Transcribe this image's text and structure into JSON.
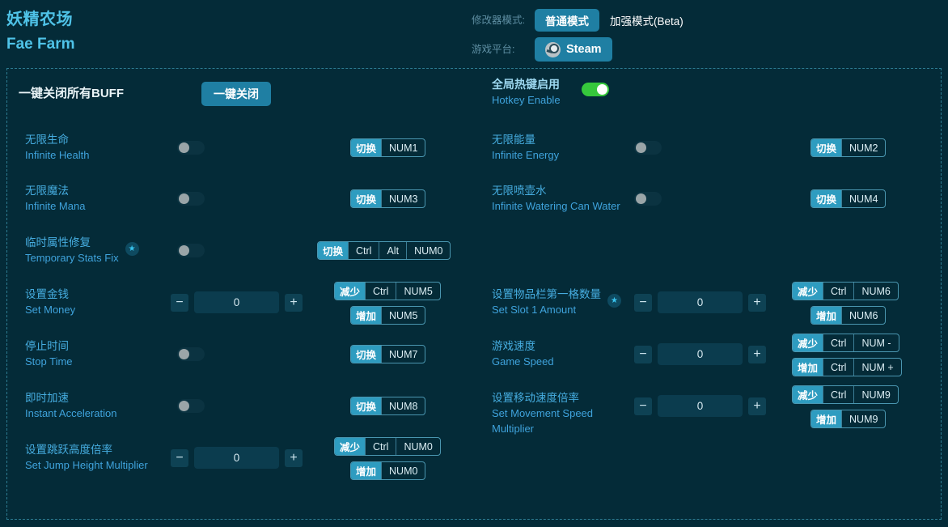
{
  "header": {
    "title_cn": "妖精农场",
    "title_en": "Fae Farm",
    "mode_label": "修改器模式:",
    "mode_normal": "普通模式",
    "mode_enhanced": "加强模式(Beta)",
    "platform_label": "游戏平台:",
    "platform_value": "Steam",
    "star_glyph": "★",
    "minus_glyph": "−",
    "plus_glyph": "+"
  },
  "left": {
    "close_all": {
      "label_cn": "一键关闭所有BUFF",
      "button": "一键关闭"
    },
    "rows": [
      {
        "label_cn": "无限生命",
        "label_en": "Infinite Health",
        "hotkeys": [
          {
            "action": "切换",
            "keys": [
              "NUM1"
            ]
          }
        ]
      },
      {
        "label_cn": "无限魔法",
        "label_en": "Infinite Mana",
        "hotkeys": [
          {
            "action": "切换",
            "keys": [
              "NUM3"
            ]
          }
        ]
      },
      {
        "label_cn": "临时属性修复",
        "label_en": "Temporary Stats Fix",
        "star": true,
        "hotkeys": [
          {
            "action": "切换",
            "keys": [
              "Ctrl",
              "Alt",
              "NUM0"
            ]
          }
        ]
      },
      {
        "label_cn": "设置金钱",
        "label_en": "Set Money",
        "value": "0",
        "hotkeys": [
          {
            "action": "减少",
            "keys": [
              "Ctrl",
              "NUM5"
            ]
          },
          {
            "action": "增加",
            "keys": [
              "NUM5"
            ]
          }
        ]
      },
      {
        "label_cn": "停止时间",
        "label_en": "Stop Time",
        "hotkeys": [
          {
            "action": "切换",
            "keys": [
              "NUM7"
            ]
          }
        ]
      },
      {
        "label_cn": "即时加速",
        "label_en": "Instant Acceleration",
        "hotkeys": [
          {
            "action": "切换",
            "keys": [
              "NUM8"
            ]
          }
        ]
      },
      {
        "label_cn": "设置跳跃高度倍率",
        "label_en": "Set Jump Height Multiplier",
        "value": "0",
        "hotkeys": [
          {
            "action": "减少",
            "keys": [
              "Ctrl",
              "NUM0"
            ]
          },
          {
            "action": "增加",
            "keys": [
              "NUM0"
            ]
          }
        ]
      }
    ]
  },
  "right": {
    "hotkey_enable": {
      "label_cn": "全局热键启用",
      "label_en": "Hotkey Enable",
      "state": "on"
    },
    "rows": [
      {
        "label_cn": "无限能量",
        "label_en": "Infinite Energy",
        "hotkeys": [
          {
            "action": "切换",
            "keys": [
              "NUM2"
            ]
          }
        ]
      },
      {
        "label_cn": "无限喷壶水",
        "label_en": "Infinite Watering Can Water",
        "hotkeys": [
          {
            "action": "切换",
            "keys": [
              "NUM4"
            ]
          }
        ]
      },
      {
        "label_cn": "设置物品栏第一格数量",
        "label_en": "Set Slot 1 Amount",
        "star": true,
        "value": "0",
        "hotkeys": [
          {
            "action": "减少",
            "keys": [
              "Ctrl",
              "NUM6"
            ]
          },
          {
            "action": "增加",
            "keys": [
              "NUM6"
            ]
          }
        ]
      },
      {
        "label_cn": "游戏速度",
        "label_en": "Game Speed",
        "value": "0",
        "hotkeys": [
          {
            "action": "减少",
            "keys": [
              "Ctrl",
              "NUM -"
            ]
          },
          {
            "action": "增加",
            "keys": [
              "Ctrl",
              "NUM +"
            ]
          }
        ]
      },
      {
        "label_cn": "设置移动速度倍率",
        "label_en": "Set Movement Speed Multiplier",
        "value": "0",
        "hotkeys": [
          {
            "action": "减少",
            "keys": [
              "Ctrl",
              "NUM9"
            ]
          },
          {
            "action": "增加",
            "keys": [
              "NUM9"
            ]
          }
        ]
      }
    ]
  },
  "colors": {
    "background": "#042B38",
    "accent": "#1F7FA3",
    "label_cn": "#46ADE0",
    "label_en": "#3FA3DC",
    "toggle_on": "#36C83C",
    "border": "#2D7C92"
  }
}
